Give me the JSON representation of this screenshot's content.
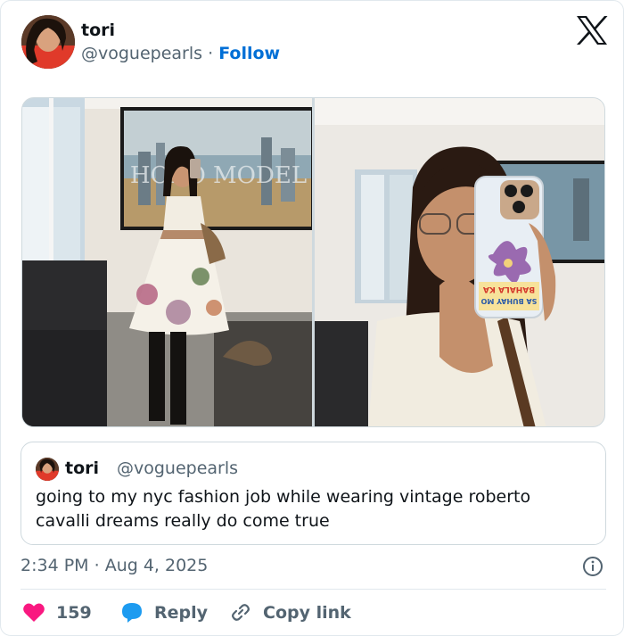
{
  "author": {
    "display_name": "tori",
    "handle": "@voguepearls",
    "separator": "·",
    "follow_label": "Follow"
  },
  "media": {
    "left_screen_text": "HORO MODEL",
    "phone_sticker_line1": "BAHALA KA",
    "phone_sticker_line2": "SA BUHAY MO"
  },
  "quote": {
    "display_name": "tori",
    "handle": "@voguepearls",
    "text": "going to my nyc fashion job while wearing vintage roberto cavalli dreams really do come true"
  },
  "meta": {
    "time": "2:34 PM",
    "separator": "·",
    "date": "Aug 4, 2025"
  },
  "actions": {
    "like_count": "159",
    "reply_label": "Reply",
    "copy_label": "Copy link"
  },
  "colors": {
    "like": "#f91880",
    "reply": "#1d9bf0",
    "link": "#006fd6",
    "muted": "#536471"
  }
}
